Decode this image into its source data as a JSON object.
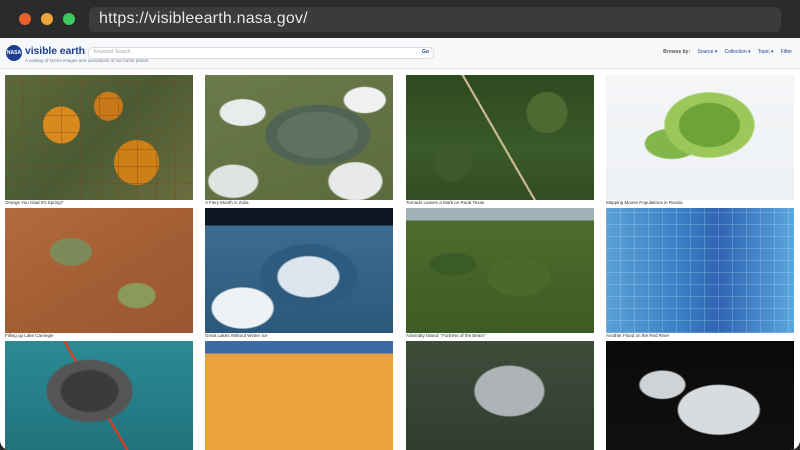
{
  "browser": {
    "url": "https://visibleearth.nasa.gov/"
  },
  "header": {
    "logo_text": "NASA",
    "brand": "visible earth",
    "tagline": "A catalog of NASA images and animations of our home planet",
    "search_placeholder": "Keyword Search",
    "search_button": "Go",
    "browse_label": "Browse by:",
    "nav": [
      "Source ▾",
      "Collection ▾",
      "Topic ▾",
      "Filter"
    ]
  },
  "cards": [
    {
      "caption": "Orange You Glad It's Spring?"
    },
    {
      "caption": "A Fiery Month in Zulia"
    },
    {
      "caption": "Tornado Leaves a Mark on Rural Texas"
    },
    {
      "caption": "Mapping Moose Populations in Russia"
    },
    {
      "caption": "Filling up Lake Carnegie"
    },
    {
      "caption": "Great Lakes Without Winter Ice"
    },
    {
      "caption": "Admiralty Island: \"Fortress of the Bears\""
    },
    {
      "caption": "Another Flood on the Red River"
    },
    {
      "caption": ""
    },
    {
      "caption": ""
    },
    {
      "caption": ""
    },
    {
      "caption": ""
    }
  ]
}
